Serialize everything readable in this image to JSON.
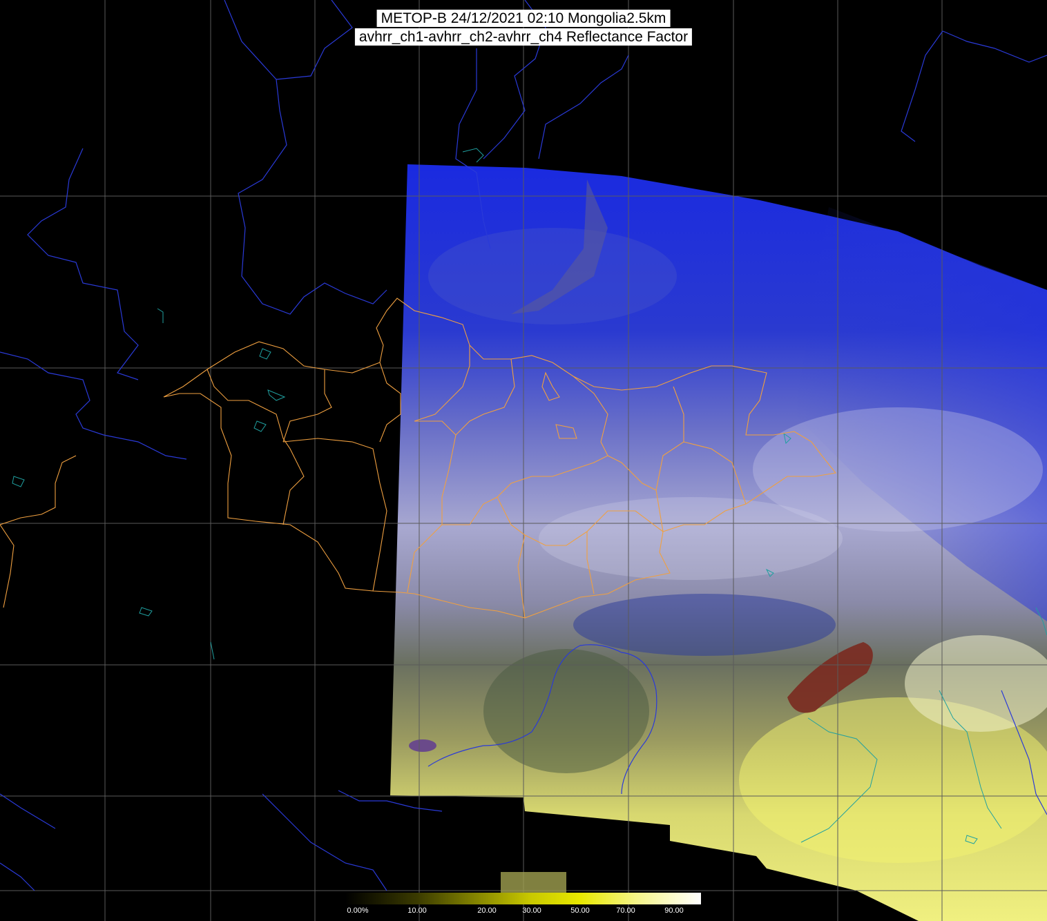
{
  "title": {
    "line1": "METOP-B 24/12/2021 02:10 Mongolia2.5km",
    "line2": "avhrr_ch1-avhrr_ch2-avhrr_ch4 Reflectance Factor"
  },
  "colorbar": {
    "labels": [
      "0.00%",
      "10.00",
      "20.00",
      "30.00",
      "50.00",
      "70.00",
      "90.00"
    ],
    "stops": [
      "#000000",
      "#3a3a00",
      "#8a8a00",
      "#c8c800",
      "#e8e800",
      "#f4f48a",
      "#ffffff"
    ]
  },
  "colors": {
    "background": "#000000",
    "grid": "#5a5a5a",
    "rivers": "#2a3ad8",
    "borders": "#f0a040",
    "coast": "#20a0a0",
    "snow_forest": "#1a2ad8",
    "cloud": "#c8c8e8",
    "desert": "#e8e060"
  }
}
